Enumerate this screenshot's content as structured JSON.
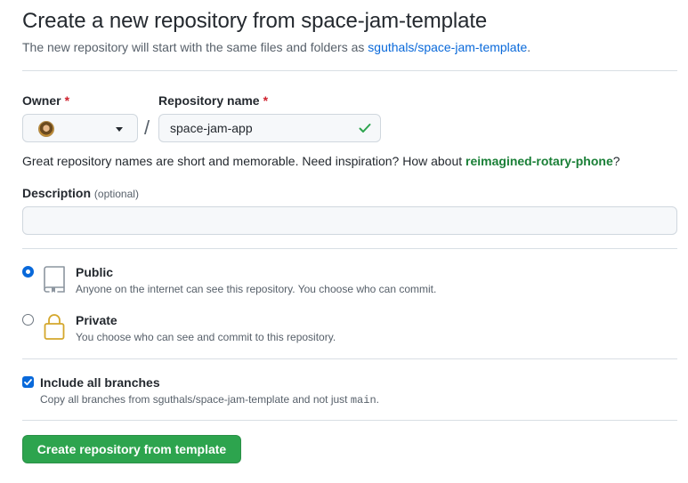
{
  "header": {
    "title": "Create a new repository from space-jam-template",
    "subtitle_prefix": "The new repository will start with the same files and folders as ",
    "template_link": "sguthals/space-jam-template",
    "subtitle_suffix": "."
  },
  "owner": {
    "label": "Owner",
    "required_mark": "*",
    "avatar_icon": "user-avatar",
    "dropdown_icon": "caret-down"
  },
  "repo_name": {
    "label": "Repository name",
    "required_mark": "*",
    "separator": "/",
    "value": "space-jam-app",
    "valid_icon": "check-icon"
  },
  "hint": {
    "text": "Great repository names are short and memorable. Need inspiration? How about ",
    "suggestion": "reimagined-rotary-phone",
    "suffix": "?"
  },
  "description": {
    "label": "Description",
    "optional_label": "(optional)",
    "value": ""
  },
  "visibility": {
    "options": [
      {
        "title": "Public",
        "description": "Anyone on the internet can see this repository. You choose who can commit.",
        "icon": "repo-icon",
        "selected": true
      },
      {
        "title": "Private",
        "description": "You choose who can see and commit to this repository.",
        "icon": "lock-icon",
        "selected": false
      }
    ]
  },
  "branches": {
    "title": "Include all branches",
    "desc_prefix": "Copy all branches from sguthals/space-jam-template and not just ",
    "branch": "main",
    "desc_suffix": ".",
    "checked": true
  },
  "submit": {
    "label": "Create repository from template"
  },
  "colors": {
    "accent": "#0969da",
    "success": "#2da44e",
    "danger": "#cf222e",
    "suggestion": "#1a7f37",
    "muted": "#57606a"
  }
}
